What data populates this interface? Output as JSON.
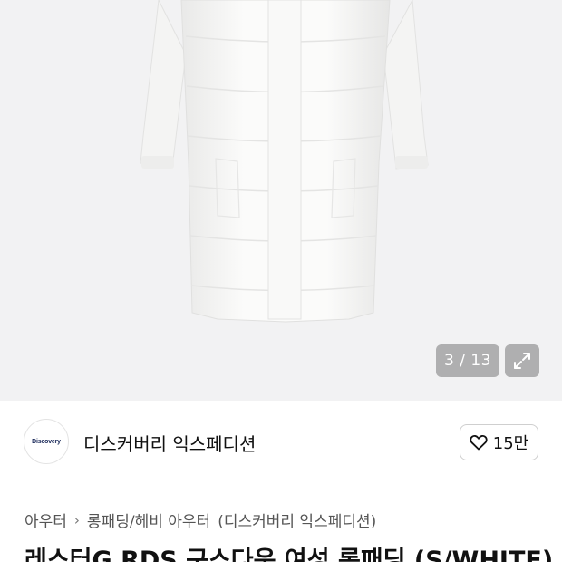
{
  "gallery": {
    "counter": "3 / 13",
    "expand_icon": "expand-arrows-icon"
  },
  "brand": {
    "logo_text": "Discovery",
    "name": "디스커버리 익스페디션",
    "like_count": "15만",
    "like_icon": "heart-outline-icon"
  },
  "breadcrumb": {
    "items": [
      "아우터",
      "롱패딩/헤비 아우터",
      "(디스커버리 익스페디션)"
    ],
    "separator_icon": "chevron-right-icon"
  },
  "product": {
    "title": "레스터G RDS 구스다운 여성 롱패딩 (S/WHITE)"
  },
  "colors": {
    "gallery_bg": "#f2f2f3",
    "coat": "#f8f8f7",
    "badge_bg": "#8a8a8a"
  }
}
